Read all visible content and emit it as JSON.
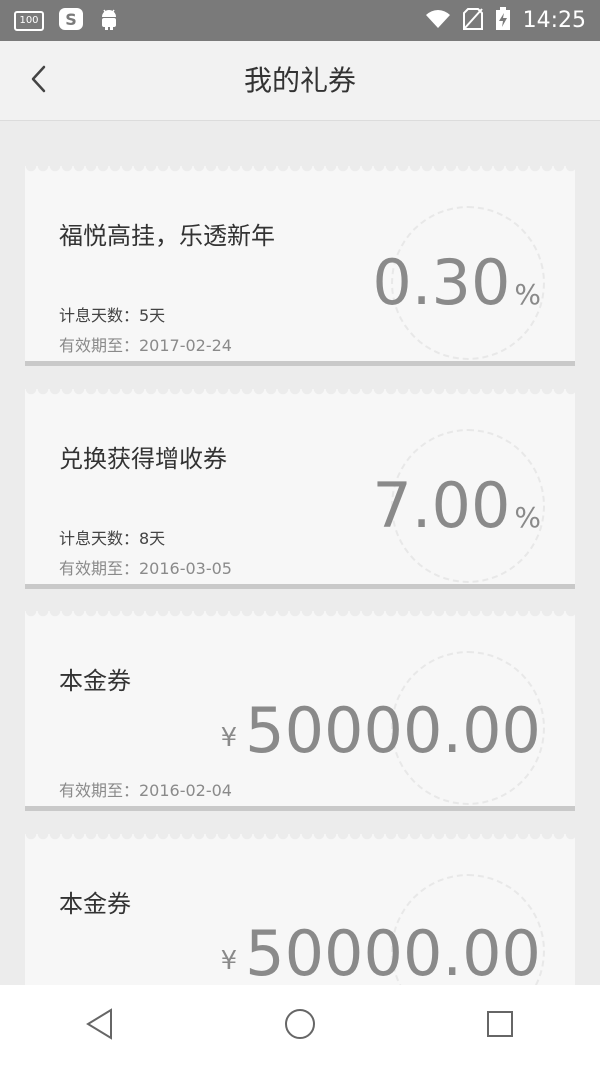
{
  "status_bar": {
    "battery_badge": "100",
    "time": "14:25"
  },
  "header": {
    "title": "我的礼券"
  },
  "coupons": [
    {
      "title": "福悦高挂，乐透新年",
      "value": "0.30",
      "unit": "%",
      "days": "计息天数：5天",
      "expiry": "有效期至：2017-02-24"
    },
    {
      "title": "兑换获得增收券",
      "value": "7.00",
      "unit": "%",
      "days": "计息天数：8天",
      "expiry": "有效期至：2016-03-05"
    },
    {
      "title": "本金券",
      "currency": "¥",
      "value": "50000.00",
      "expiry": "有效期至：2016-02-04"
    },
    {
      "title": "本金券",
      "currency": "¥",
      "value": "50000.00"
    }
  ],
  "icons": {
    "back": "chevron-left-icon",
    "nav_back": "triangle-back-icon",
    "nav_home": "circle-home-icon",
    "nav_recents": "square-recents-icon"
  }
}
